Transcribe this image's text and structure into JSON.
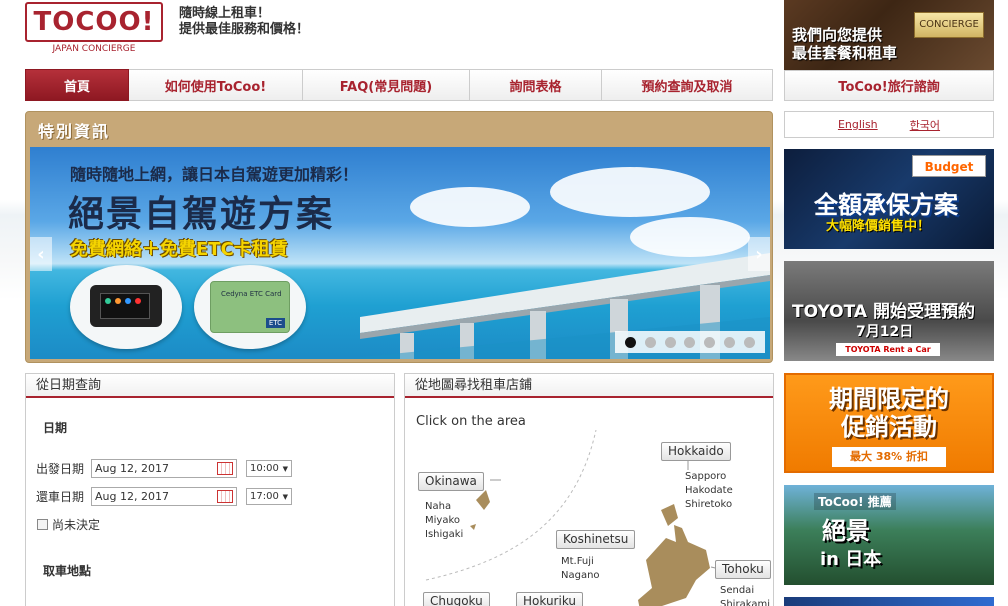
{
  "header": {
    "logo": "TOCOO!",
    "logo_sub": "JAPAN CONCIERGE",
    "tagline_line1": "隨時線上租車！",
    "tagline_line2": "提供最佳服務和價格！"
  },
  "nav": {
    "items": [
      {
        "label": "首頁"
      },
      {
        "label": "如何使用ToCoo!"
      },
      {
        "label": "FAQ(常見問題)"
      },
      {
        "label": "詢問表格"
      },
      {
        "label": "預約查詢及取消"
      }
    ]
  },
  "special": {
    "title": "特別資訊",
    "banner_line1": "隨時隨地上網，讓日本自駕遊更加精彩！",
    "banner_line2": "絕景自駕遊方案",
    "banner_line3": "免費網絡＋免費ETC卡租賃",
    "etc_card_name": "Cedyna ETC Card",
    "etc_card_label": "ETC",
    "slide_count": 7,
    "active_slide": 1
  },
  "date_search": {
    "heading": "從日期查詢",
    "date_label": "日期",
    "depart_label": "出發日期",
    "depart_date": "Aug 12, 2017",
    "depart_time": "10:00",
    "return_label": "還車日期",
    "return_date": "Aug 12, 2017",
    "return_time": "17:00",
    "undecided_label": "尚未決定",
    "pickup_label": "取車地點"
  },
  "map_search": {
    "heading": "從地圖尋找租車店鋪",
    "instruction": "Click on the area",
    "regions": {
      "okinawa": {
        "label": "Okinawa",
        "cities": [
          "Naha",
          "Miyako",
          "Ishigaki"
        ]
      },
      "hokkaido": {
        "label": "Hokkaido",
        "cities": [
          "Sapporo",
          "Hakodate",
          "Shiretoko"
        ]
      },
      "koshinetsu": {
        "label": "Koshinetsu",
        "cities": [
          "Mt.Fuji",
          "Nagano"
        ]
      },
      "tohoku": {
        "label": "Tohoku",
        "cities": [
          "Sendai",
          "Shirakami"
        ]
      },
      "chugoku": {
        "label": "Chugoku"
      },
      "hokuriku": {
        "label": "Hokuriku"
      }
    }
  },
  "sidebar": {
    "concierge_sign": "CONCIERGE",
    "top_banner_line1": "我們向您提供",
    "top_banner_line2": "最佳套餐和租車",
    "consult_button": "ToCoo!旅行諮詢",
    "lang_english": "English",
    "lang_korean": "한국어",
    "budget_logo": "Budget",
    "budget_line1": "全額承保方案",
    "budget_line2": "大幅降價銷售中！",
    "toyota_line1": "TOYOTA 開始受理預約",
    "toyota_line2": "7月12日",
    "toyota_logo": "TOYOTA Rent a Car",
    "promo_line1": "期間限定的",
    "promo_line2": "促銷活動",
    "promo_discount": "最大 38% 折扣",
    "scenic_tag": "ToCoo! 推薦",
    "scenic_line1": "絕景",
    "scenic_line2": "in 日本"
  },
  "colors": {
    "brand": "#a8232f",
    "gold_panel": "#c7a878",
    "promo_orange": "#f07b00"
  }
}
